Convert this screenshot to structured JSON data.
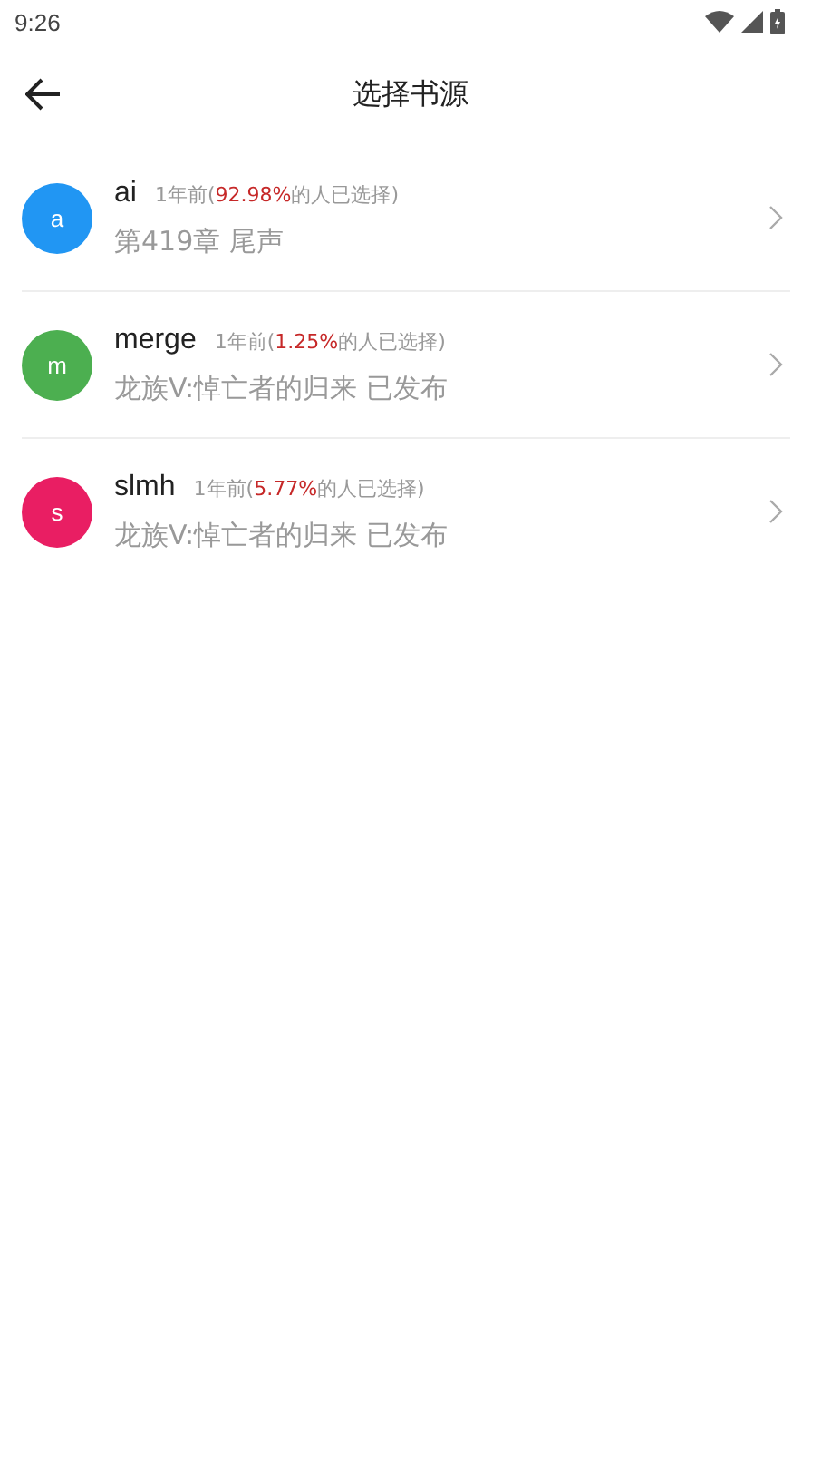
{
  "status_bar": {
    "time": "9:26"
  },
  "toolbar": {
    "title": "选择书源"
  },
  "sources": [
    {
      "avatar": "a",
      "color": "#2196f3",
      "name": "ai",
      "meta_prefix": "1年前(",
      "percent": "92.98%",
      "meta_suffix": "的人已选择)",
      "latest": "第419章 尾声"
    },
    {
      "avatar": "m",
      "color": "#4caf50",
      "name": "merge",
      "meta_prefix": "1年前(",
      "percent": "1.25%",
      "meta_suffix": "的人已选择)",
      "latest": "龙族V:悼亡者的归来 已发布"
    },
    {
      "avatar": "s",
      "color": "#e91e63",
      "name": "slmh",
      "meta_prefix": "1年前(",
      "percent": "5.77%",
      "meta_suffix": "的人已选择)",
      "latest": "龙族V:悼亡者的归来 已发布"
    }
  ]
}
